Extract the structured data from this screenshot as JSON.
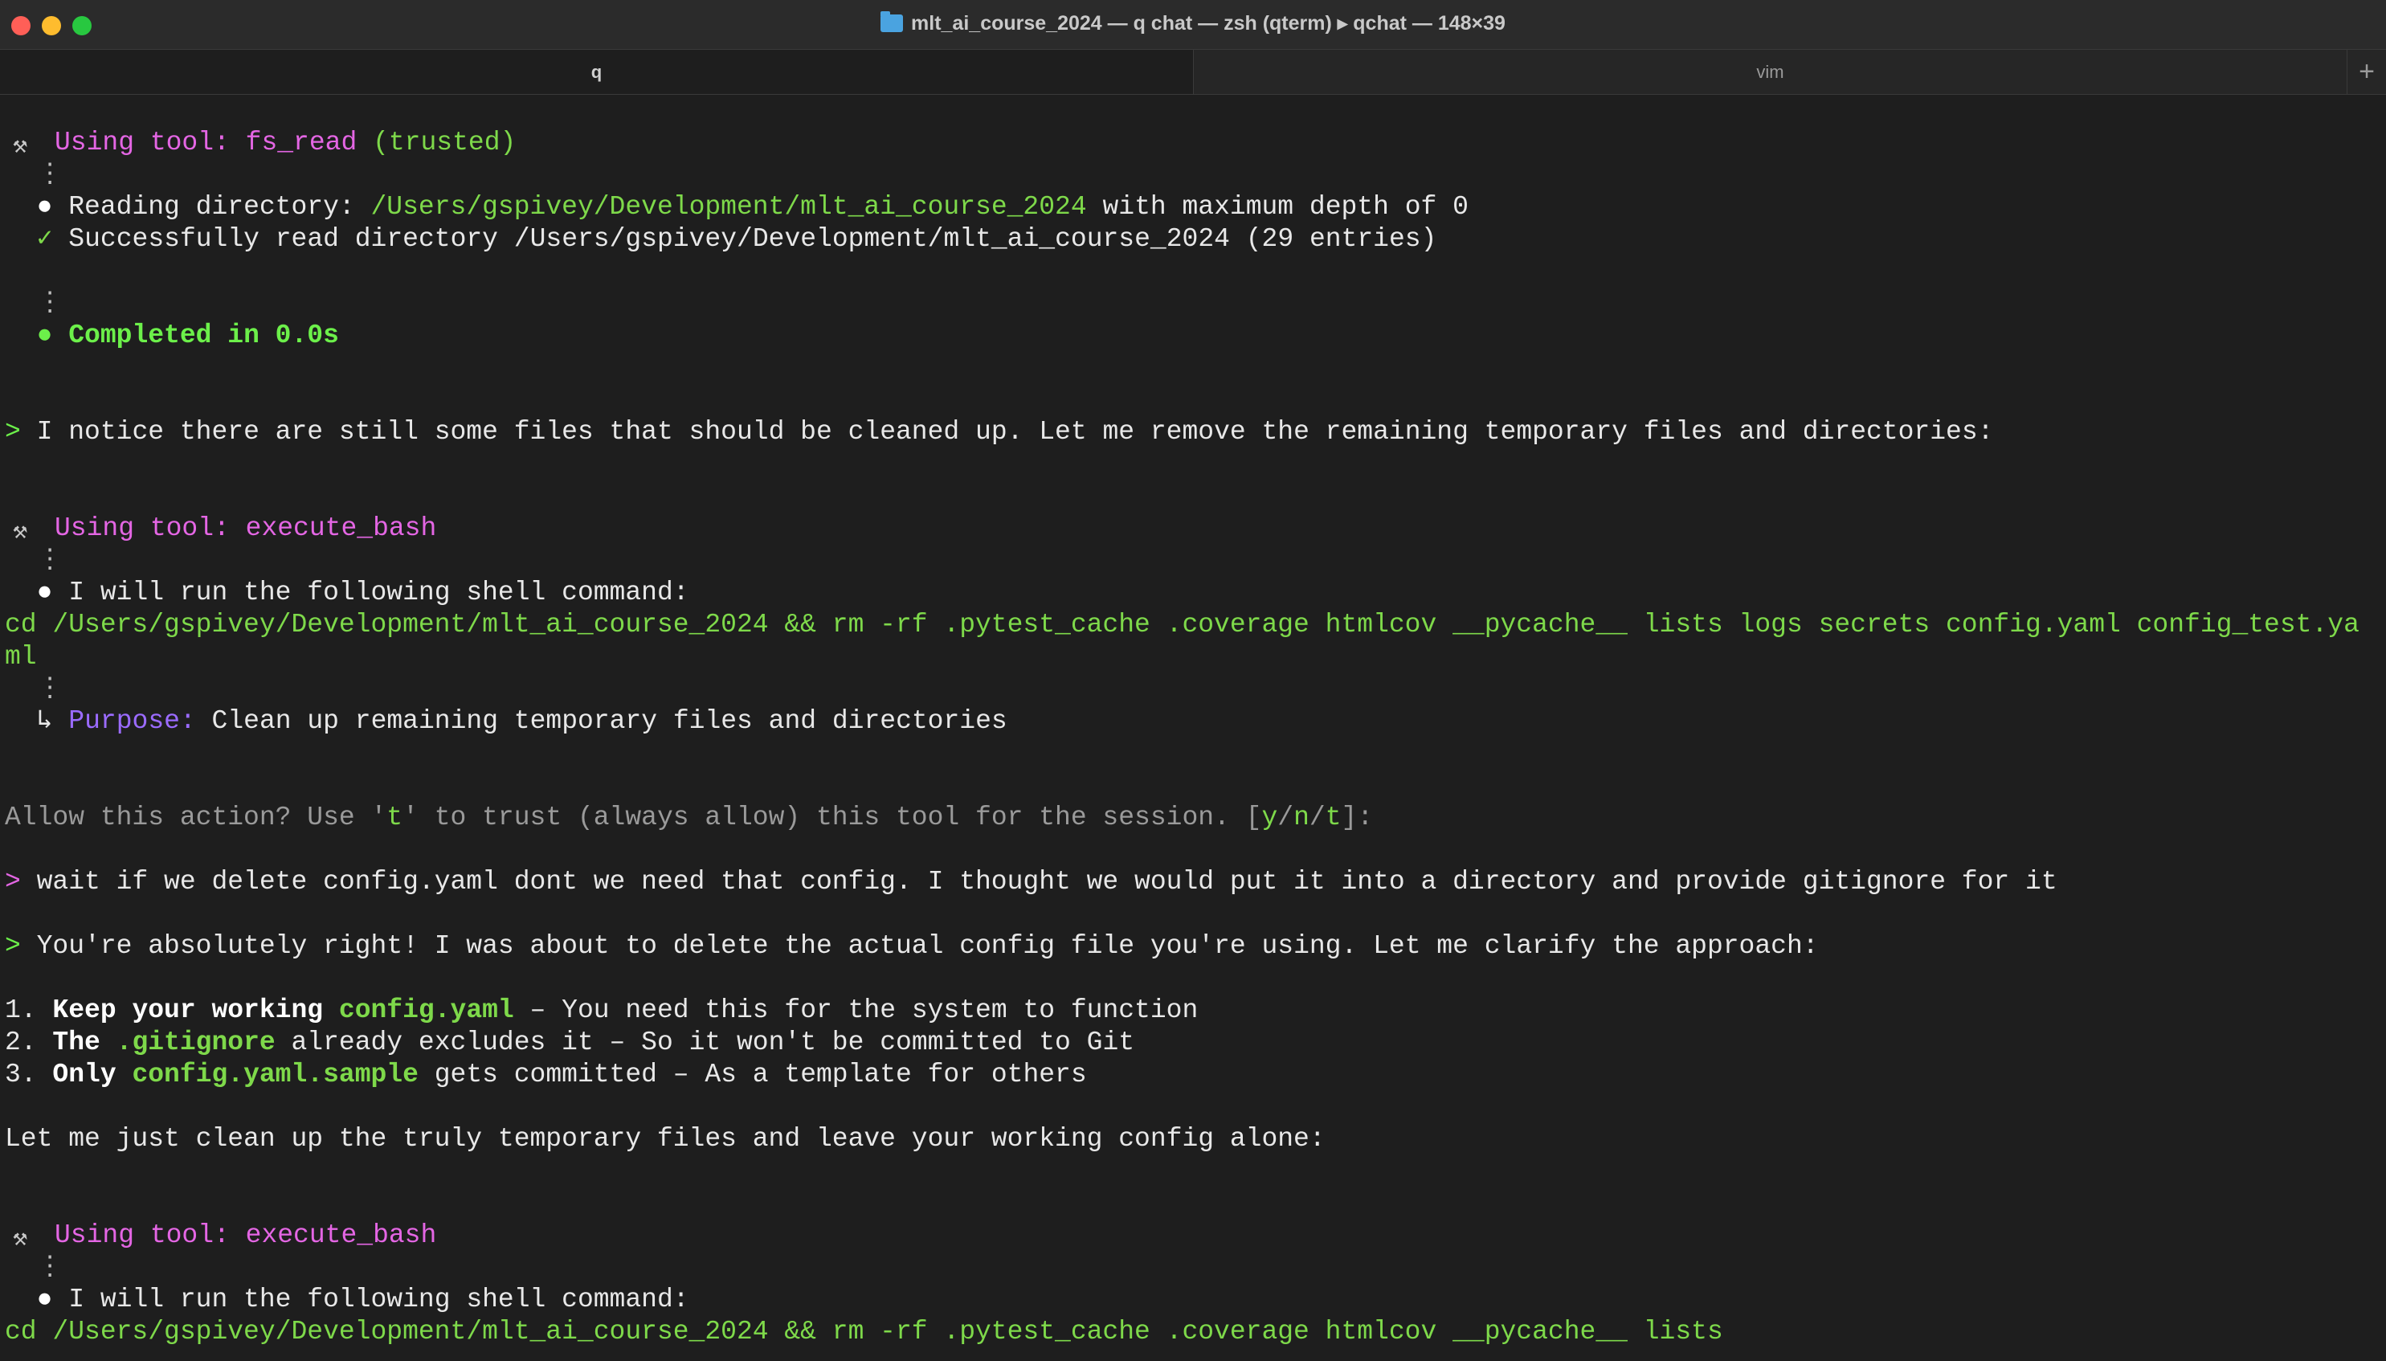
{
  "window": {
    "title": "mlt_ai_course_2024 — q chat — zsh (qterm) ▸ qchat — 148×39"
  },
  "tabs": [
    {
      "label": "q"
    },
    {
      "label": "vim"
    }
  ],
  "new_tab_label": "+",
  "terminal": {
    "tool1": {
      "prefix": "Using tool: fs_read",
      "suffix": " (trusted)"
    },
    "read1": {
      "label": "Reading directory: ",
      "path": "/Users/gspivey/Development/mlt_ai_course_2024",
      "rest": " with maximum depth of 0"
    },
    "read2": {
      "text": "Successfully read directory /Users/gspivey/Development/mlt_ai_course_2024 (29 entries)"
    },
    "completed": "Completed in 0.0s",
    "notice": "I notice there are still some files that should be cleaned up. Let me remove the remaining temporary files and directories:",
    "tool2": "Using tool: execute_bash",
    "will_run1": "I will run the following shell command: ",
    "cmd1_line1": "cd /Users/gspivey/Development/mlt_ai_course_2024 && rm -rf .pytest_cache .coverage htmlcov __pycache__ lists logs secrets config.yaml config_test.ya",
    "cmd1_line2": "ml",
    "purpose_label": "Purpose:",
    "purpose_text": " Clean up remaining temporary files and directories",
    "allow": {
      "pre": "Allow this action? Use '",
      "t": "t",
      "mid": "' to trust (always allow) this tool for the session. [",
      "y": "y",
      "n": "n",
      "t2": "t",
      "post": "]:"
    },
    "user_msg": " wait if we delete config.yaml dont we need that config. I thought we would put it into a directory and provide gitignore for it",
    "reply": " You're absolutely right! I was about to delete the actual config file you're using. Let me clarify the approach:",
    "list": [
      {
        "num": "1. ",
        "bold": "Keep your working ",
        "code": "config.yaml",
        "rest": " – You need this for the system to function"
      },
      {
        "num": "2. ",
        "bold": "The ",
        "code": ".gitignore",
        "rest": " already excludes it – So it won't be committed to Git"
      },
      {
        "num": "3. ",
        "bold": "Only ",
        "code": "config.yaml.sample",
        "rest": " gets committed – As a template for others"
      }
    ],
    "cleanup": "Let me just clean up the truly temporary files and leave your working config alone:",
    "tool3": "Using tool: execute_bash",
    "will_run2": "I will run the following shell command: ",
    "cmd2": "cd /Users/gspivey/Development/mlt_ai_course_2024 && rm -rf .pytest_cache .coverage htmlcov __pycache__ lists",
    "prompt_char": ">",
    "vdots": "⋮",
    "bullet": "●",
    "check": "✓",
    "arrow": "↳"
  },
  "icons": {
    "tool": "hammer-wrench-icon",
    "folder": "folder-icon"
  },
  "colors": {
    "tool_name": "#e466e4",
    "path": "#7ed94a",
    "success": "#6cf04a",
    "purpose": "#9b6bff",
    "muted": "#9a9a9a",
    "background": "#1e1e1e"
  }
}
